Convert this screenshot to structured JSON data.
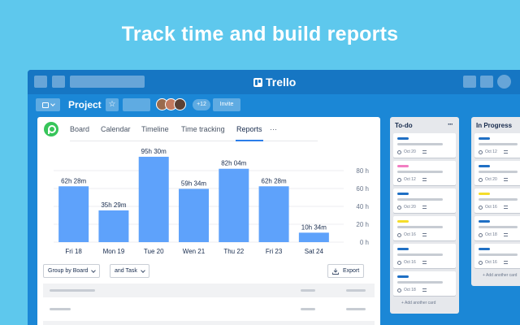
{
  "headline": "Track time and build reports",
  "window": {
    "app_name": "Trello"
  },
  "board": {
    "title": "Project",
    "member_overflow": "+12",
    "invite_label": "Invite",
    "members": [
      {
        "color": "#9a6b4d"
      },
      {
        "color": "#c27a5f"
      },
      {
        "color": "#5b4135"
      }
    ]
  },
  "tabs": [
    {
      "label": "Board"
    },
    {
      "label": "Calendar"
    },
    {
      "label": "Timeline"
    },
    {
      "label": "Time tracking"
    },
    {
      "label": "Reports"
    },
    {
      "label": "···"
    }
  ],
  "chart_data": {
    "type": "bar",
    "categories": [
      "Fri 18",
      "Mon 19",
      "Tue 20",
      "Wen 21",
      "Thu 22",
      "Fri 23",
      "Sat 24"
    ],
    "values": [
      62.47,
      35.48,
      95.5,
      59.57,
      82.07,
      62.47,
      10.57
    ],
    "data_labels": [
      "62h 28m",
      "35h 29m",
      "95h 30m",
      "59h 34m",
      "82h 04m",
      "62h 28m",
      "10h 34m"
    ],
    "y_ticks": [
      "80 h",
      "60 h",
      "40 h",
      "20 h",
      "0 h"
    ],
    "y_tick_values": [
      80,
      60,
      40,
      20,
      0
    ],
    "ylim": [
      0,
      100
    ],
    "color": "#5ea2fb",
    "grid": true
  },
  "controls": {
    "group_by": "Group by Board",
    "and_task": "and Task",
    "export": "Export"
  },
  "lists": [
    {
      "title": "To-do",
      "menu": "···",
      "add_card": "+ Add another card",
      "cards": [
        {
          "label_color": "#1f6fc4",
          "date": "Oct 20"
        },
        {
          "label_color": "#f27ec2",
          "date": "Oct 12"
        },
        {
          "label_color": "#1f6fc4",
          "date": "Oct 20"
        },
        {
          "label_color": "#f5dd2a",
          "date": "Oct 16"
        },
        {
          "label_color": "#1f6fc4",
          "date": "Oct 16"
        },
        {
          "label_color": "#1f6fc4",
          "date": "Oct 18"
        }
      ]
    },
    {
      "title": "In Progress",
      "add_card": "+ Add another card",
      "cards": [
        {
          "label_color": "#1f6fc4",
          "date": "Oct 12"
        },
        {
          "label_color": "#1f6fc4",
          "date": "Oct 20"
        },
        {
          "label_color": "#f5dd2a",
          "date": "Oct 16"
        },
        {
          "label_color": "#1f6fc4",
          "date": "Oct 18"
        },
        {
          "label_color": "#1f6fc4",
          "date": "Oct 16"
        }
      ]
    }
  ]
}
